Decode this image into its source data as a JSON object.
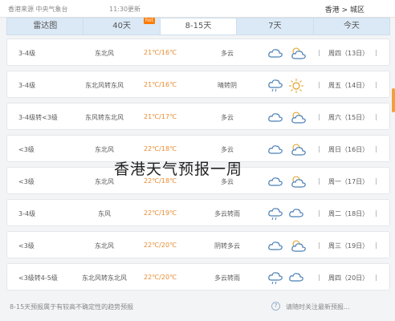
{
  "header": {
    "source": "香港来源 中央气象台",
    "time": "11:30更新",
    "breadcrumb": "香港 > 城区"
  },
  "tabs": [
    {
      "label": "雷达图",
      "active": false
    },
    {
      "label": "40天",
      "active": false,
      "badge": "hot"
    },
    {
      "label": "8-15天",
      "active": true
    },
    {
      "label": "7天",
      "active": false
    },
    {
      "label": "今天",
      "active": false
    }
  ],
  "rows": [
    {
      "wind_level": "3-4级",
      "wind_dir": "东北风",
      "temp": "21℃/16℃",
      "weather": "多云",
      "date": "周四（13日）"
    },
    {
      "wind_level": "3-4级",
      "wind_dir": "东北风转东风",
      "temp": "21℃/16℃",
      "weather": "晴转阴",
      "date": "周五（14日）"
    },
    {
      "wind_level": "3-4级转<3级",
      "wind_dir": "东风转东北风",
      "temp": "21℃/17℃",
      "weather": "多云",
      "date": "周六（15日）"
    },
    {
      "wind_level": "<3级",
      "wind_dir": "东北风",
      "temp": "22℃/18℃",
      "weather": "多云",
      "date": "周日（16日）"
    },
    {
      "wind_level": "<3级",
      "wind_dir": "东北风",
      "temp": "22℃/18℃",
      "weather": "多云",
      "date": "周一（17日）"
    },
    {
      "wind_level": "3-4级",
      "wind_dir": "东风",
      "temp": "22℃/19℃",
      "weather": "多云转雨",
      "date": "周二（18日）"
    },
    {
      "wind_level": "<3级",
      "wind_dir": "东北风",
      "temp": "22℃/20℃",
      "weather": "阴转多云",
      "date": "周三（19日）"
    },
    {
      "wind_level": "<3级转4-5级",
      "wind_dir": "东北风转东北风",
      "temp": "22℃/20℃",
      "weather": "多云转雨",
      "date": "周四（20日）"
    }
  ],
  "overlay_title": "香港天气预报一周",
  "footer": {
    "note": "8-15天预报属于有较高不确定性的趋势预报",
    "note2": "请随时关注最新预报..."
  },
  "colors": {
    "tab_bg": "#dbe9f6",
    "temp": "#e78a2f",
    "icon_blue": "#4a7fb5"
  }
}
